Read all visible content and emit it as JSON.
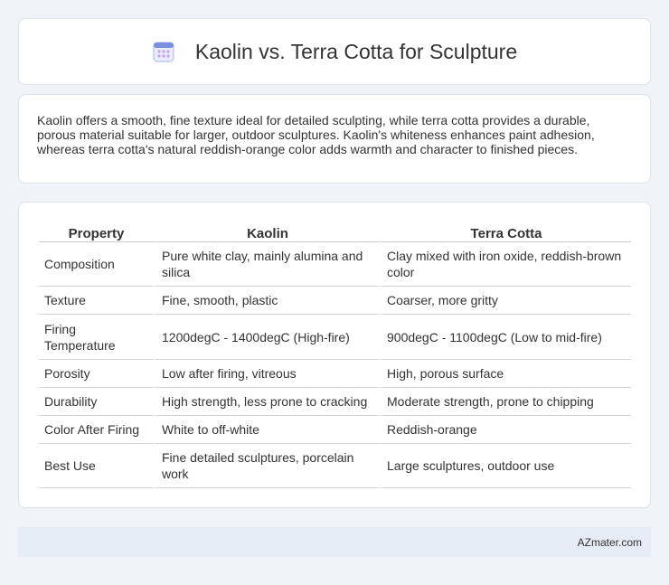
{
  "header": {
    "title": "Kaolin vs. Terra Cotta for Sculpture",
    "icon": "calendar-icon"
  },
  "intro": {
    "text": "Kaolin offers a smooth, fine texture ideal for detailed sculpting, while terra cotta provides a durable, porous material suitable for larger, outdoor sculptures. Kaolin's whiteness enhances paint adhesion, whereas terra cotta's natural reddish-orange color adds warmth and character to finished pieces."
  },
  "table": {
    "headers": [
      "Property",
      "Kaolin",
      "Terra Cotta"
    ],
    "rows": [
      [
        "Composition",
        "Pure white clay, mainly alumina and silica",
        "Clay mixed with iron oxide, reddish-brown color"
      ],
      [
        "Texture",
        "Fine, smooth, plastic",
        "Coarser, more gritty"
      ],
      [
        "Firing Temperature",
        "1200degC - 1400degC (High-fire)",
        "900degC - 1100degC (Low to mid-fire)"
      ],
      [
        "Porosity",
        "Low after firing, vitreous",
        "High, porous surface"
      ],
      [
        "Durability",
        "High strength, less prone to cracking",
        "Moderate strength, prone to chipping"
      ],
      [
        "Color After Firing",
        "White to off-white",
        "Reddish-orange"
      ],
      [
        "Best Use",
        "Fine detailed sculptures, porcelain work",
        "Large sculptures, outdoor use"
      ]
    ]
  },
  "footer": {
    "brand": "AZmater.com"
  },
  "colors": {
    "background": "#f0f3f8",
    "card": "#ffffff",
    "footer_bg": "#e5ecf6",
    "icon_accent": "#7b8fe0"
  }
}
